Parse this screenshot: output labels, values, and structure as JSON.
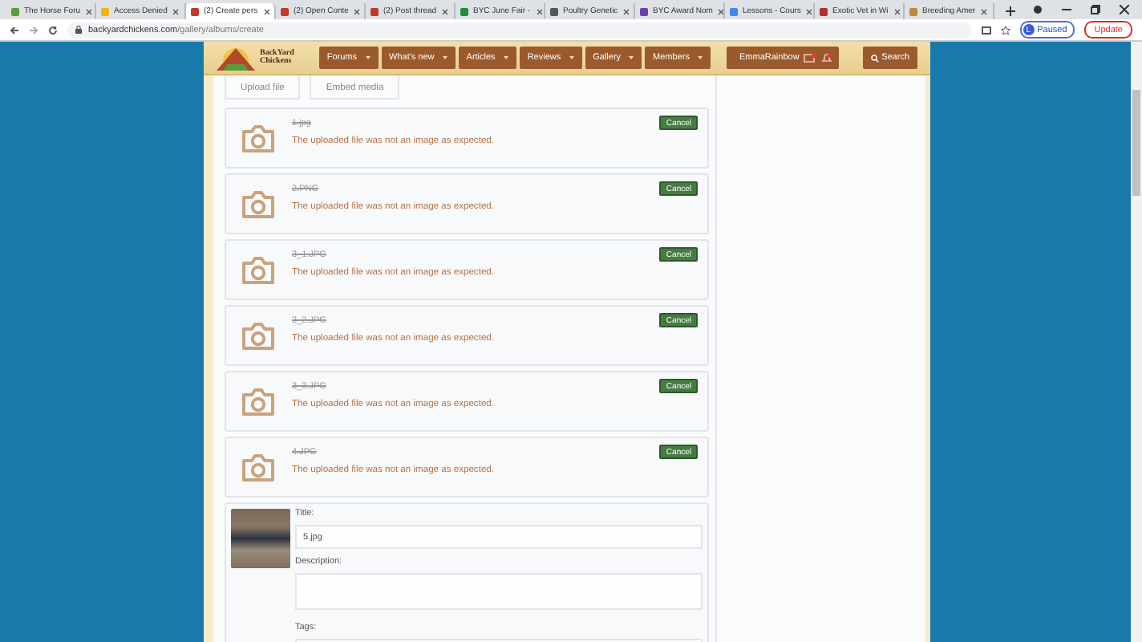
{
  "browser": {
    "tabs": [
      {
        "title": "The Horse Foru",
        "selected": false
      },
      {
        "title": "Access Denied",
        "selected": false
      },
      {
        "title": "(2) Create pers",
        "selected": true
      },
      {
        "title": "(2) Open Conte",
        "selected": false
      },
      {
        "title": "(2) Post thread",
        "selected": false
      },
      {
        "title": "BYC June Fair -",
        "selected": false
      },
      {
        "title": "Poultry Genetic",
        "selected": false
      },
      {
        "title": "BYC Award Nom",
        "selected": false
      },
      {
        "title": "Lessons - Cours",
        "selected": false
      },
      {
        "title": "Exotic Vet in Wi",
        "selected": false
      },
      {
        "title": "Breeding Amer",
        "selected": false
      }
    ],
    "url": {
      "domain": "backyardchickens.com",
      "path": "/gallery/albums/create"
    },
    "profile": {
      "initial": "L",
      "label": "Paused"
    },
    "update": "Update"
  },
  "site": {
    "logo": [
      "BackYard",
      "Chickens"
    ],
    "nav": [
      "Forums",
      "What's new",
      "Articles",
      "Reviews",
      "Gallery",
      "Members"
    ],
    "user": "EmmaRainbow",
    "search": "Search"
  },
  "upload_buttons": [
    "Upload file",
    "Embed media"
  ],
  "uploads": [
    {
      "kind": "failed",
      "filename": "1.jpg",
      "error": "The uploaded file was not an image as expected.",
      "cancel": "Cancel"
    },
    {
      "kind": "failed",
      "filename": "2.PNG",
      "error": "The uploaded file was not an image as expected.",
      "cancel": "Cancel"
    },
    {
      "kind": "failed",
      "filename": "3_1.JPG",
      "error": "The uploaded file was not an image as expected.",
      "cancel": "Cancel"
    },
    {
      "kind": "failed",
      "filename": "3_2.JPG",
      "error": "The uploaded file was not an image as expected.",
      "cancel": "Cancel"
    },
    {
      "kind": "failed",
      "filename": "3_3.JPG",
      "error": "The uploaded file was not an image as expected.",
      "cancel": "Cancel"
    },
    {
      "kind": "failed",
      "filename": "4.JPG",
      "error": "The uploaded file was not an image as expected.",
      "cancel": "Cancel"
    },
    {
      "kind": "pending",
      "fields": [
        {
          "label": "Title:",
          "kind": "input",
          "value": "5.jpg"
        },
        {
          "label": "Description:",
          "kind": "textarea"
        },
        {
          "label": "Tags:",
          "kind": "input"
        }
      ]
    }
  ]
}
